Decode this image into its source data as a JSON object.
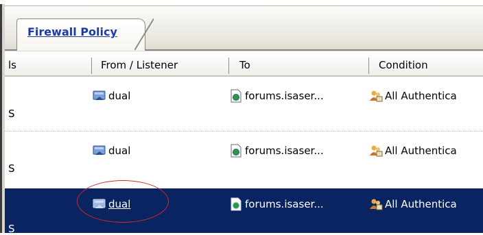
{
  "tab": {
    "label": "Firewall Policy"
  },
  "columns": [
    {
      "label": "ls"
    },
    {
      "label": "From / Listener"
    },
    {
      "label": "To"
    },
    {
      "label": "Condition"
    }
  ],
  "rows": [
    {
      "first": "S",
      "from": "dual",
      "to": "forums.isaser...",
      "condition": "All Authentica",
      "selected": false
    },
    {
      "first": "S",
      "from": "dual",
      "to": "forums.isaser...",
      "condition": "All Authentica",
      "selected": false
    },
    {
      "first": "S",
      "from": "dual",
      "to": "forums.isaser...",
      "condition": "All Authentica",
      "selected": true
    }
  ],
  "icons": {
    "from": "network-listener-icon",
    "to": "url-set-icon",
    "condition": "authenticated-users-icon"
  },
  "colors": {
    "selected_row": "#0a2461",
    "tab_text": "#1d3aa6",
    "annotation": "#d4262a"
  }
}
